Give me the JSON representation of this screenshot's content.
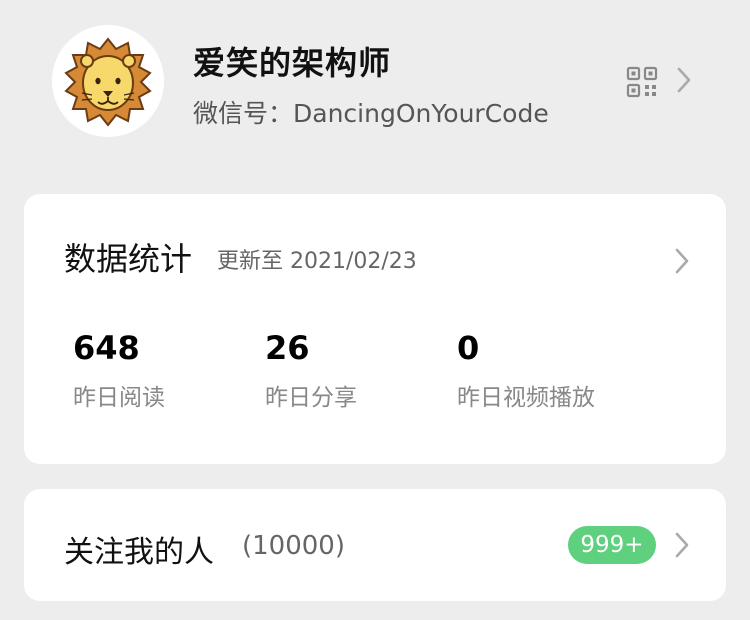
{
  "profile": {
    "nickname": "爱笑的架构师",
    "wechat_id": "微信号：DancingOnYourCode",
    "avatar_icon": "lion-avatar",
    "qr_icon": "qr-code-icon"
  },
  "stats": {
    "title": "数据统计",
    "updated": "更新至 2021/02/23",
    "metrics": [
      {
        "value": "648",
        "label": "昨日阅读"
      },
      {
        "value": "26",
        "label": "昨日分享"
      },
      {
        "value": "0",
        "label": "昨日视频播放"
      }
    ]
  },
  "followers": {
    "label": "关注我的人",
    "count": "(10000)",
    "badge": "999+"
  },
  "colors": {
    "background": "#ededed",
    "card": "#ffffff",
    "badge": "#5fd07d",
    "avatar_mane": "#d68a35",
    "avatar_face": "#f7d86a"
  }
}
